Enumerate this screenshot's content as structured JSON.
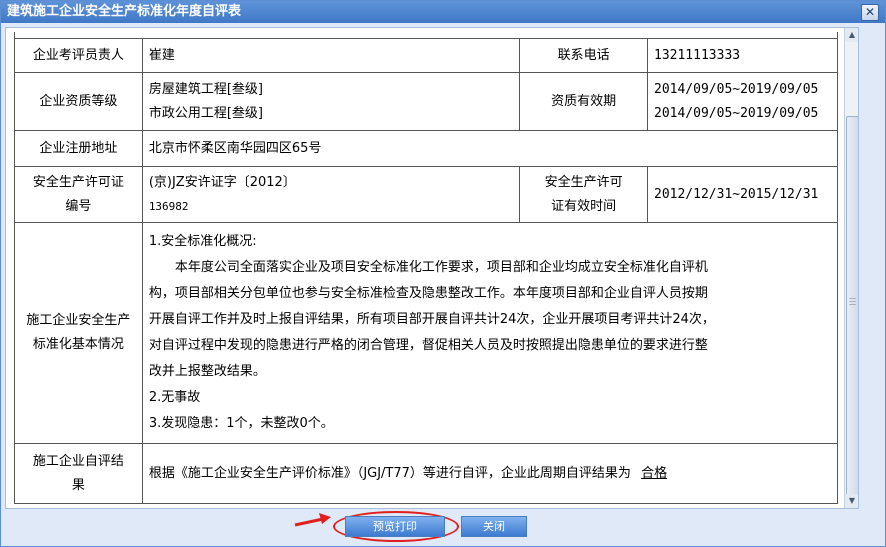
{
  "window": {
    "title": "建筑施工企业安全生产标准化年度自评表",
    "close_glyph": "✕"
  },
  "rows": {
    "evaluator": {
      "label": "企业考评员责人",
      "value": "崔建",
      "phone_label": "联系电话",
      "phone": "13211113333"
    },
    "qualification": {
      "label": "企业资质等级",
      "grades": [
        "房屋建筑工程[叁级]",
        "市政公用工程[叁级]"
      ],
      "validity_label": "资质有效期",
      "validity": [
        "2014/09/05~2019/09/05",
        "2014/09/05~2019/09/05"
      ]
    },
    "address": {
      "label": "企业注册地址",
      "value": "北京市怀柔区南华园四区65号"
    },
    "license": {
      "label_line1": "安全生产许可证",
      "label_line2": "编号",
      "value_line1": "(京)JZ安许证字〔2012〕",
      "value_line2": "136982",
      "validity_label_line1": "安全生产许可",
      "validity_label_line2": "证有效时间",
      "validity": "2012/12/31~2015/12/31"
    },
    "situation": {
      "label": "施工企业安全生产标准化基本情况",
      "heading": "1.安全标准化概况:",
      "paragraph": "本年度公司全面落实企业及项目安全标准化工作要求，项目部和企业均成立安全标准化自评机构，项目部相关分包单位也参与安全标准检查及隐患整改工作。本年度项目部和企业自评人员按期开展自评工作并及时上报自评结果，所有项目部开展自评共计24次，企业开展项目考评共计24次，对自评过程中发现的隐患进行严格的闭合管理，督促相关人员及时按照提出隐患单位的要求进行整改并上报整改结果。",
      "item2": "2.无事故",
      "item3": "3.发现隐患：1个，未整改0个。"
    },
    "result": {
      "label": "施工企业自评结果",
      "text": "根据《施工企业安全生产评价标准》（JGJ/T77）等进行自评，企业此周期自评结果为",
      "result_value": "合格"
    }
  },
  "buttons": {
    "preview_print": "预览打印",
    "close": "关闭"
  }
}
